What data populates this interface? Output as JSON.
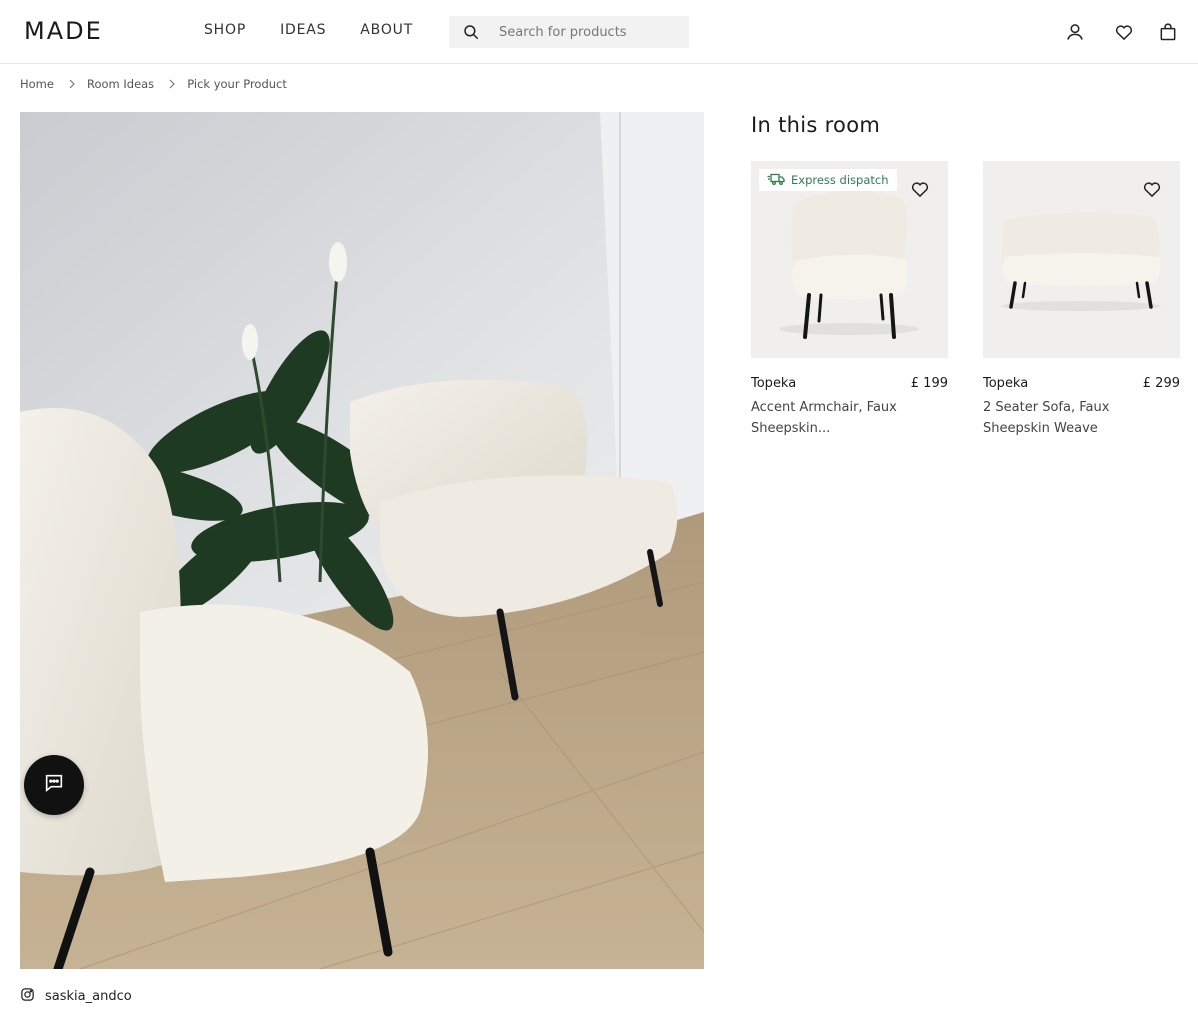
{
  "header": {
    "logo": "MADE",
    "nav": [
      "SHOP",
      "IDEAS",
      "ABOUT"
    ],
    "search_placeholder": "Search for products"
  },
  "breadcrumb": [
    "Home",
    "Room Ideas",
    "Pick your Product"
  ],
  "room": {
    "credit": "saskia_andco"
  },
  "panel": {
    "title": "In this room",
    "products": [
      {
        "badge": "Express dispatch",
        "name": "Topeka",
        "price": "£ 199",
        "description": "Accent Armchair, Faux Sheepskin..."
      },
      {
        "name": "Topeka",
        "price": "£ 299",
        "description": "2 Seater Sofa, Faux Sheepskin Weave"
      }
    ]
  },
  "colors": {
    "badge_green": "#2e7d4f",
    "search_bg": "#f2f2f2",
    "chat_button": "#111111"
  },
  "icons": [
    "search-icon",
    "account-icon",
    "wishlist-icon",
    "basket-icon",
    "chevron-right-icon",
    "chat-icon",
    "instagram-icon",
    "truck-icon",
    "heart-icon"
  ]
}
